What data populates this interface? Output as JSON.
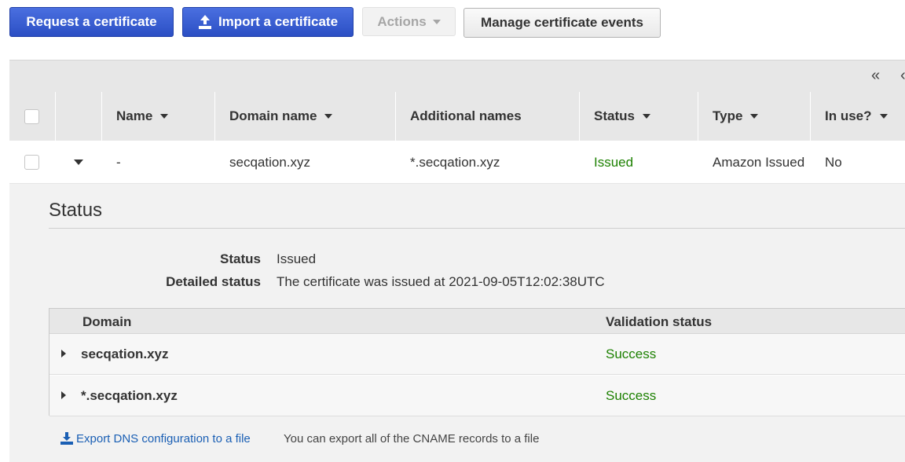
{
  "toolbar": {
    "request_label": "Request a certificate",
    "import_label": "Import a certificate",
    "actions_label": "Actions",
    "manage_events_label": "Manage certificate events"
  },
  "pager": {
    "first": "«",
    "prev": "‹"
  },
  "table": {
    "columns": [
      "Name",
      "Domain name",
      "Additional names",
      "Status",
      "Type",
      "In use?"
    ],
    "rows": [
      {
        "name": "-",
        "domain": "secqation.xyz",
        "additional": "*.secqation.xyz",
        "status": "Issued",
        "type": "Amazon Issued",
        "in_use": "No"
      }
    ]
  },
  "detail": {
    "title": "Status",
    "status_label": "Status",
    "status_value": "Issued",
    "detailed_label": "Detailed status",
    "detailed_value": "The certificate was issued at 2021-09-05T12:02:38UTC",
    "validation_table": {
      "columns": [
        "Domain",
        "Validation status"
      ],
      "rows": [
        {
          "domain": "secqation.xyz",
          "status": "Success"
        },
        {
          "domain": "*.secqation.xyz",
          "status": "Success"
        }
      ]
    },
    "export_link": "Export DNS configuration to a file",
    "export_note": "You can export all of the CNAME records to a file"
  },
  "colors": {
    "primary": "#3b5fd6",
    "success": "#1d8102",
    "link": "#1a5fb4"
  },
  "icons": [
    "upload-icon",
    "caret-down-icon",
    "double-chevron-left-icon",
    "chevron-left-icon",
    "caret-right-icon",
    "download-icon"
  ]
}
